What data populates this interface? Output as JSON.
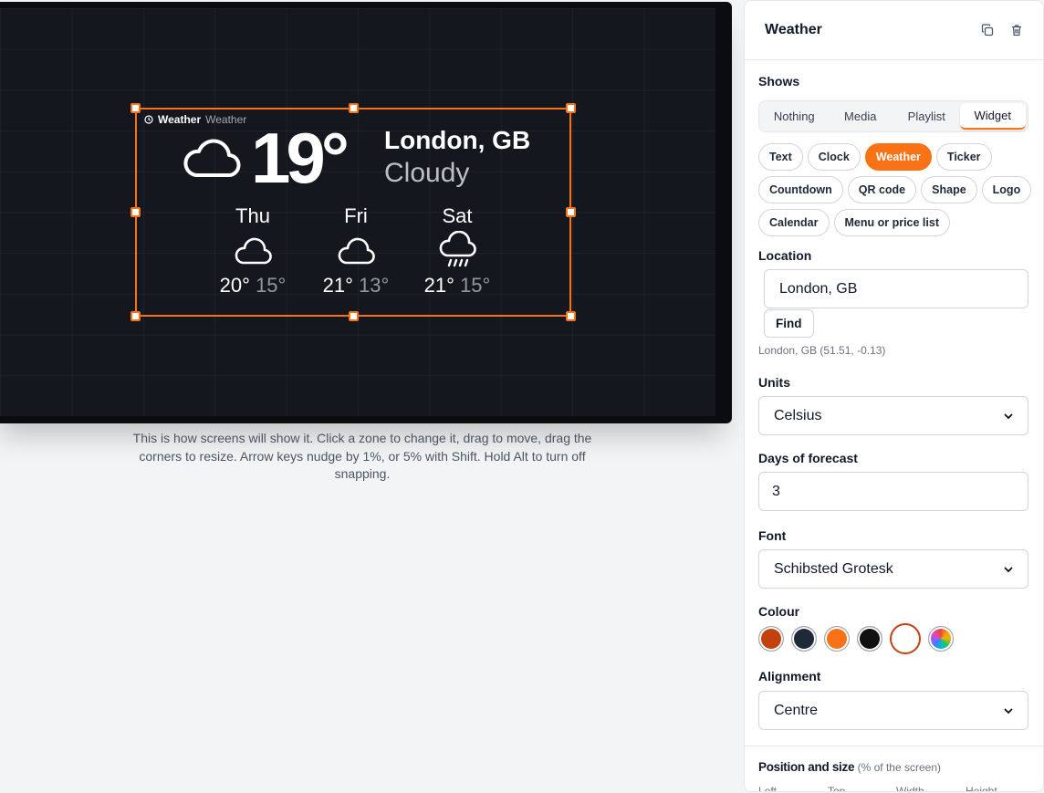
{
  "preview": {
    "zone_tag_bold": "Weather",
    "zone_tag_label": "Weather",
    "current_temp": "19°",
    "location": "London, GB",
    "condition": "Cloudy",
    "icons": {
      "current": "cloud-icon"
    },
    "forecast": [
      {
        "day": "Thu",
        "high": "20°",
        "low": "15°",
        "icon": "cloud-icon"
      },
      {
        "day": "Fri",
        "high": "21°",
        "low": "13°",
        "icon": "cloud-icon"
      },
      {
        "day": "Sat",
        "high": "21°",
        "low": "15°",
        "icon": "cloud-rain-icon"
      }
    ],
    "hint": "This is how screens will show it. Click a zone to change it, drag to move, drag the corners to resize. Arrow keys nudge by 1%, or 5% with Shift. Hold Alt to turn off snapping."
  },
  "panel": {
    "title": "Weather",
    "icons": {
      "duplicate": "copy-icon",
      "delete": "trash-icon"
    },
    "shows_label": "Shows",
    "shows_options": [
      "Nothing",
      "Media",
      "Playlist",
      "Widget"
    ],
    "shows_selected": "Widget",
    "widget_types": [
      "Text",
      "Clock",
      "Weather",
      "Ticker",
      "Countdown",
      "QR code",
      "Shape",
      "Logo",
      "Calendar",
      "Menu or price list"
    ],
    "widget_selected": "Weather",
    "location_label": "Location",
    "location_value": "London, GB",
    "find_label": "Find",
    "location_result": "London, GB (51.51, -0.13)",
    "units_label": "Units",
    "units_value": "Celsius",
    "days_label": "Days of forecast",
    "days_value": "3",
    "font_label": "Font",
    "font_value": "Schibsted Grotesk",
    "colour_label": "Colour",
    "colours": [
      "#c2410c",
      "#1f2937",
      "#f97316",
      "#111111",
      "#ffffff",
      "rainbow"
    ],
    "colour_selected_index": 4,
    "alignment_label": "Alignment",
    "alignment_value": "Centre",
    "position_label": "Position and size",
    "position_hint": "(% of the screen)",
    "position_fields": [
      "Left",
      "Top",
      "Width",
      "Height"
    ]
  },
  "colors": {
    "accent": "#f97316",
    "screen_bg": "#15171e"
  }
}
